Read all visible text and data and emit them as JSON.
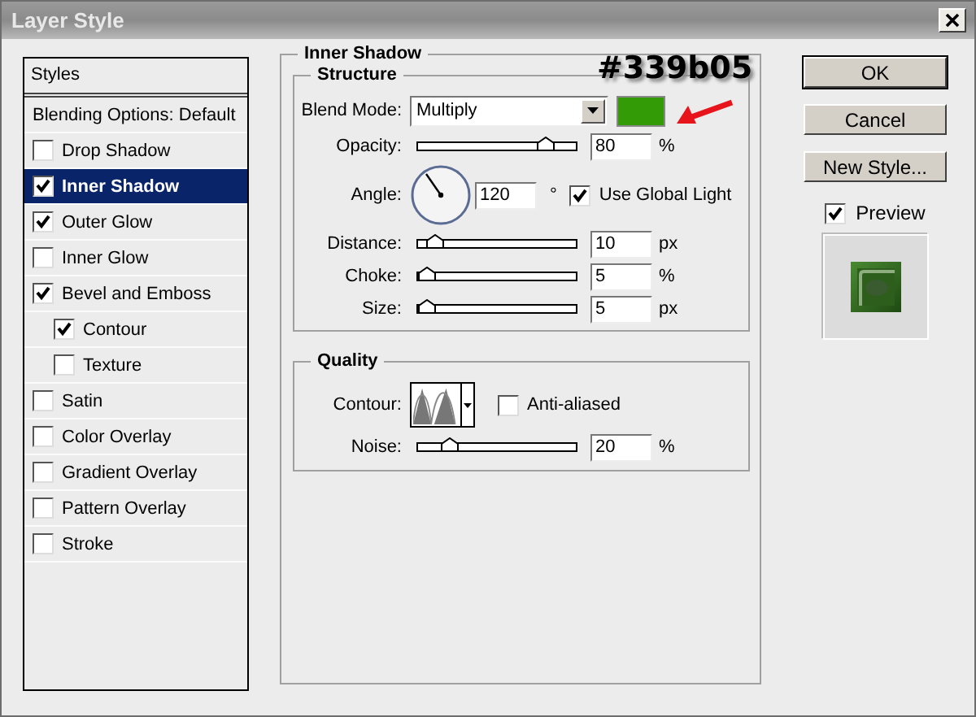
{
  "window": {
    "title": "Layer Style"
  },
  "sidebar": {
    "header": "Styles",
    "items": [
      {
        "kind": "plain",
        "label": "Blending Options: Default",
        "selected": false
      },
      {
        "kind": "check",
        "label": "Drop Shadow",
        "checked": false,
        "selected": false
      },
      {
        "kind": "check",
        "label": "Inner Shadow",
        "checked": true,
        "selected": true
      },
      {
        "kind": "check",
        "label": "Outer Glow",
        "checked": true,
        "selected": false
      },
      {
        "kind": "check",
        "label": "Inner Glow",
        "checked": false,
        "selected": false
      },
      {
        "kind": "check",
        "label": "Bevel and Emboss",
        "checked": true,
        "selected": false,
        "children": [
          {
            "kind": "check",
            "label": "Contour",
            "checked": true,
            "selected": false
          },
          {
            "kind": "check",
            "label": "Texture",
            "checked": false,
            "selected": false
          }
        ]
      },
      {
        "kind": "check",
        "label": "Satin",
        "checked": false,
        "selected": false
      },
      {
        "kind": "check",
        "label": "Color Overlay",
        "checked": false,
        "selected": false
      },
      {
        "kind": "check",
        "label": "Gradient Overlay",
        "checked": false,
        "selected": false
      },
      {
        "kind": "check",
        "label": "Pattern Overlay",
        "checked": false,
        "selected": false
      },
      {
        "kind": "check",
        "label": "Stroke",
        "checked": false,
        "selected": false
      }
    ]
  },
  "panel": {
    "title": "Inner Shadow",
    "structure": {
      "title": "Structure",
      "rows": [
        {
          "kind": "select",
          "label": "Blend Mode:",
          "value": "Multiply",
          "color": "#339b05"
        },
        {
          "kind": "slider",
          "label": "Opacity:",
          "level": 0.8,
          "value": "80",
          "unit": "%"
        },
        {
          "kind": "angle",
          "label": "Angle:",
          "value": "120",
          "unit": "°",
          "check_label": "Use Global Light",
          "checked": true
        },
        {
          "kind": "slider",
          "label": "Distance:",
          "level": 0.1,
          "value": "10",
          "unit": "px"
        },
        {
          "kind": "slider",
          "label": "Choke:",
          "level": 0.05,
          "value": "5",
          "unit": "%"
        },
        {
          "kind": "slider",
          "label": "Size:",
          "level": 0.05,
          "value": "5",
          "unit": "px"
        }
      ]
    },
    "quality": {
      "title": "Quality",
      "rows": [
        {
          "kind": "contour",
          "label": "Contour:",
          "check_label": "Anti-aliased",
          "checked": false
        },
        {
          "kind": "slider",
          "label": "Noise:",
          "level": 0.2,
          "value": "20",
          "unit": "%"
        }
      ]
    }
  },
  "annotation": {
    "text": "#339b05"
  },
  "buttons": [
    "OK",
    "Cancel",
    "New Style..."
  ],
  "preview": {
    "label": "Preview",
    "checked": true
  }
}
